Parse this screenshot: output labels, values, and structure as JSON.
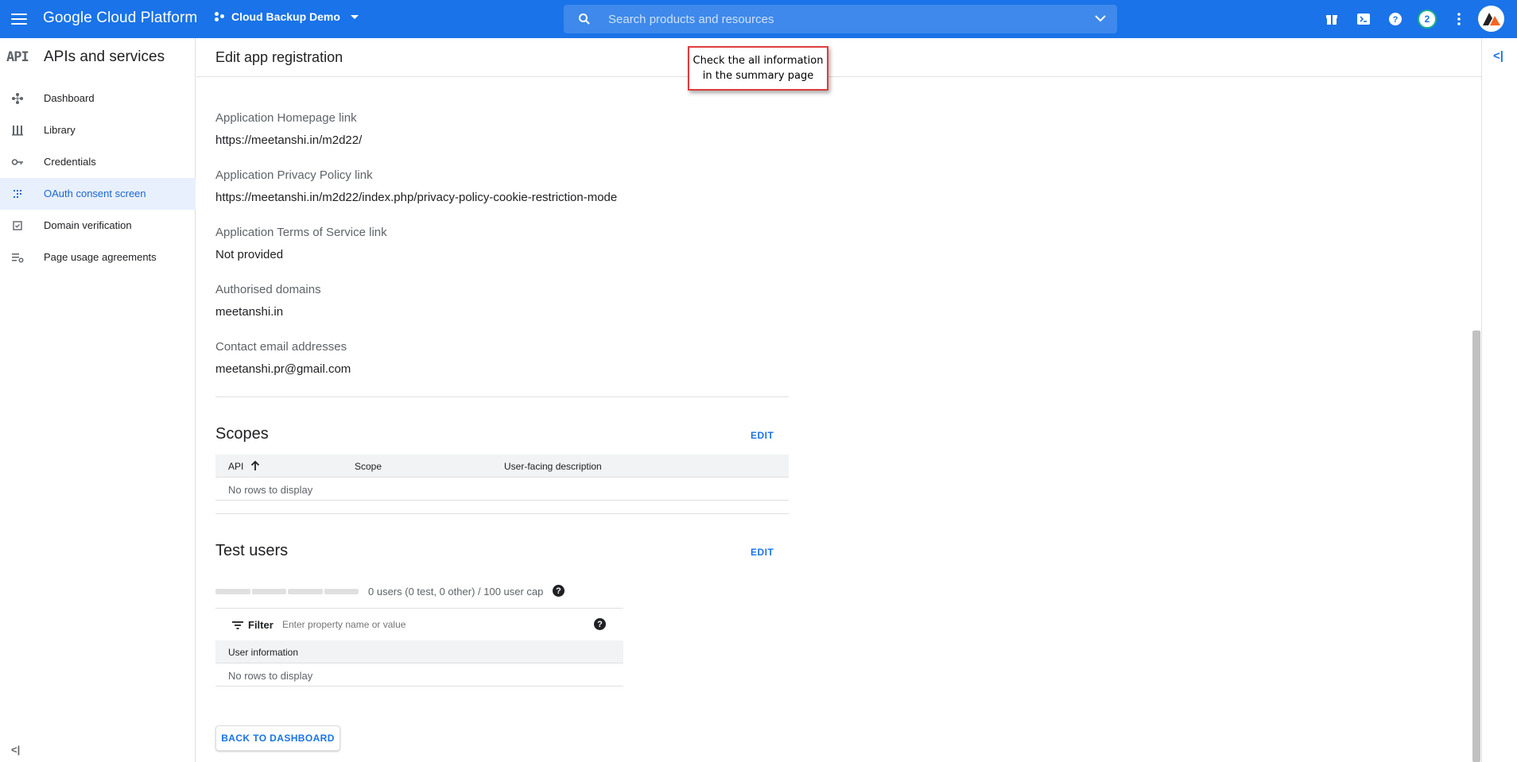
{
  "topbar": {
    "brand": "Google Cloud Platform",
    "project": "Cloud Backup Demo",
    "search_placeholder": "Search products and resources",
    "notifications_count": "2"
  },
  "sidebar": {
    "api_label": "API",
    "title": "APIs and services",
    "items": [
      {
        "label": "Dashboard",
        "icon": "dashboard-icon"
      },
      {
        "label": "Library",
        "icon": "library-icon"
      },
      {
        "label": "Credentials",
        "icon": "key-icon"
      },
      {
        "label": "OAuth consent screen",
        "icon": "oauth-icon",
        "active": true
      },
      {
        "label": "Domain verification",
        "icon": "checkbox-icon"
      },
      {
        "label": "Page usage agreements",
        "icon": "settings-list-icon"
      }
    ],
    "collapse_label": "<|"
  },
  "main": {
    "title": "Edit app registration",
    "callout": {
      "line1": "Check the all information",
      "line2": "in the summary page"
    },
    "fields": [
      {
        "label": "Application Homepage link",
        "value": "https://meetanshi.in/m2d22/"
      },
      {
        "label": "Application Privacy Policy link",
        "value": "https://meetanshi.in/m2d22/index.php/privacy-policy-cookie-restriction-mode"
      },
      {
        "label": "Application Terms of Service link",
        "value": "Not provided"
      },
      {
        "label": "Authorised domains",
        "value": "meetanshi.in"
      },
      {
        "label": "Contact email addresses",
        "value": "meetanshi.pr@gmail.com"
      }
    ],
    "scopes": {
      "title": "Scopes",
      "edit_label": "EDIT",
      "columns": [
        "API",
        "Scope",
        "User-facing description"
      ],
      "empty_text": "No rows to display"
    },
    "test_users": {
      "title": "Test users",
      "edit_label": "EDIT",
      "quota_text": "0 users (0 test, 0 other) / 100 user cap",
      "quota_used": 0,
      "filter_label": "Filter",
      "filter_placeholder": "Enter property name or value",
      "columns": [
        "User information"
      ],
      "empty_text": "No rows to display"
    },
    "back_button": "BACK TO DASHBOARD"
  },
  "colors": {
    "topbar": "#1a73e8",
    "accent": "#1967d2",
    "active_bg": "#e8f0fe",
    "callout_border": "#e03c3c"
  }
}
